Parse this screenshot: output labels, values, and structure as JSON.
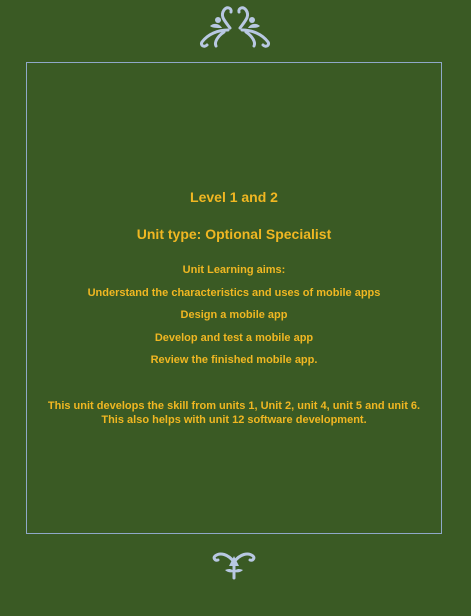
{
  "colors": {
    "background": "#3a5a24",
    "text": "#f0b722",
    "frame_border": "#8fa8c8",
    "ornament": "#b8c8e2"
  },
  "icons": {
    "top": "floral-ornament-icon",
    "bottom": "floral-ornament-icon"
  },
  "heading": {
    "level": "Level 1 and 2",
    "unit_type": "Unit type: Optional Specialist"
  },
  "aims": [
    "Unit Learning aims:",
    "Understand the characteristics and uses of mobile apps",
    "Design a mobile app",
    "Develop and test a mobile app",
    "Review the finished mobile app."
  ],
  "description": "This unit develops the skill from units 1, Unit 2, unit 4, unit 5 and unit 6. This also helps with unit 12 software development."
}
